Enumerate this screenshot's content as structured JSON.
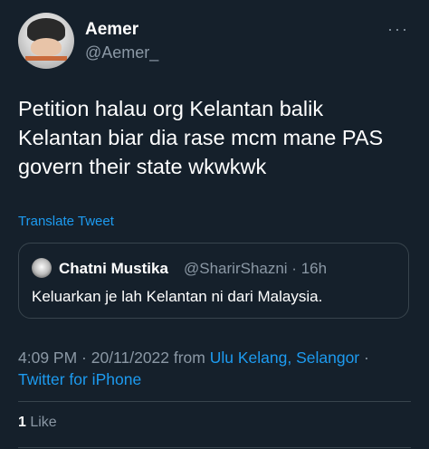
{
  "author": {
    "name": "Aemer",
    "handle": "@Aemer_"
  },
  "more_icon": "more-dots-icon",
  "tweet": {
    "text": "Petition halau org Kelantan balik\nKelantan biar dia rase mcm mane PAS\ngovern their state wkwkwk",
    "translate_label": "Translate Tweet"
  },
  "quoted": {
    "name": "Chatni Mustika",
    "handle": "@SharirShazni · 16h",
    "text": "Keluarkan je lah Kelantan ni dari Malaysia."
  },
  "meta": {
    "time": "4:09 PM · 20/11/2022 from ",
    "location": "Ulu Kelang, Selangor",
    "separator": " · ",
    "client": "Twitter for iPhone"
  },
  "engagement": {
    "like_count": "1",
    "like_label": " Like"
  },
  "colors": {
    "background": "#15202b",
    "text": "#ffffff",
    "secondary": "#8b98a5",
    "accent": "#1d9bf0",
    "border": "#38444d"
  }
}
